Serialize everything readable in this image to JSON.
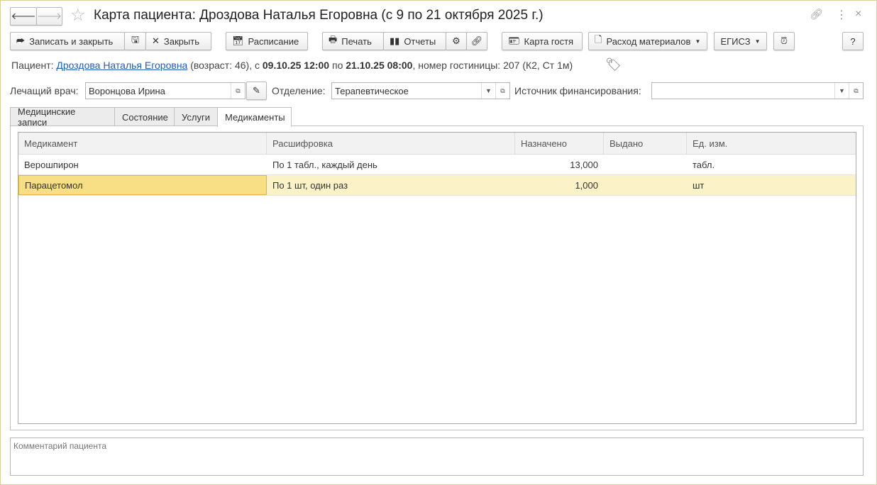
{
  "title": "Карта пациента: Дроздова Наталья Егоровна (с 9 по 21 октября 2025 г.)",
  "toolbar": {
    "save_close": "Записать и закрыть",
    "close": "Закрыть",
    "schedule": "Расписание",
    "print": "Печать",
    "reports": "Отчеты",
    "guest_card": "Карта гостя",
    "materials": "Расход материалов",
    "egisz": "ЕГИСЗ",
    "help": "?"
  },
  "patient": {
    "prefix": "Пациент: ",
    "name": "Дроздова Наталья Егоровна",
    "age": " (возраст: 46), с ",
    "from": "09.10.25 12:00",
    "mid": " по ",
    "to": "21.10.25 08:00",
    "room": ", номер гостиницы: 207 (К2, Ст 1м)"
  },
  "fields": {
    "doctor_label": "Лечащий врач:",
    "doctor": "Воронцова Ирина",
    "dept_label": "Отделение:",
    "dept": "Терапевтическое",
    "fin_label": "Источник финансирования:",
    "fin": ""
  },
  "tabs": [
    "Медицинские записи",
    "Состояние",
    "Услуги",
    "Медикаменты"
  ],
  "table": {
    "headers": [
      "Медикамент",
      "Расшифровка",
      "Назначено",
      "Выдано",
      "Ед. изм."
    ],
    "rows": [
      [
        "Верошпирон",
        "По 1 табл., каждый день",
        "13,000",
        "",
        "табл."
      ],
      [
        "Парацетомол",
        "По 1 шт, один раз",
        "1,000",
        "",
        "шт"
      ]
    ]
  },
  "comment_placeholder": "Комментарий пациента"
}
